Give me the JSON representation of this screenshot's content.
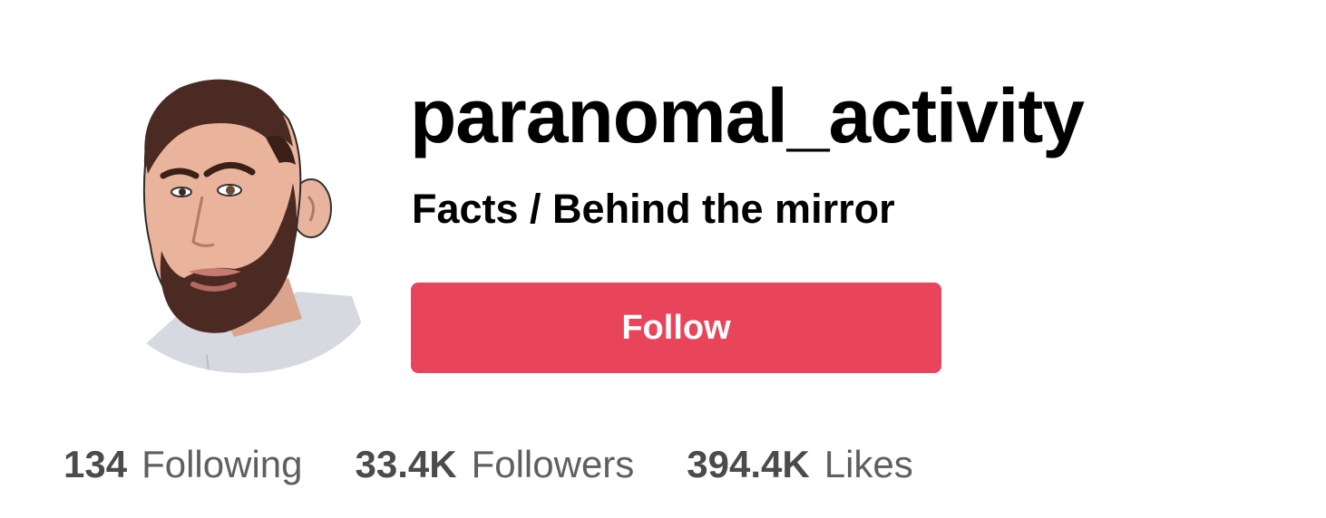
{
  "profile": {
    "username": "paranomal_activity",
    "bio": "Facts / Behind the mirror",
    "follow_label": "Follow",
    "avatar_icon": "avatar-illustration-icon"
  },
  "stats": [
    {
      "value": "134",
      "label": "Following"
    },
    {
      "value": "33.4K",
      "label": "Followers"
    },
    {
      "value": "394.4K",
      "label": "Likes"
    }
  ],
  "colors": {
    "follow_button": "#e8445a",
    "text": "#000000",
    "stat_text": "#4b4b4b"
  }
}
